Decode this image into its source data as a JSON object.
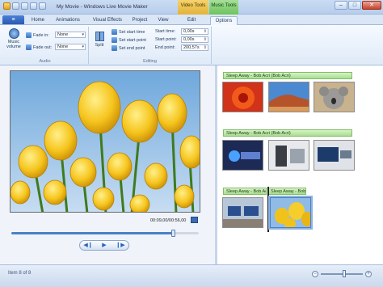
{
  "window": {
    "title": "My Movie - Windows Live Movie Maker",
    "context_tabs": [
      "Video Tools",
      "Music Tools"
    ]
  },
  "tabs": {
    "file_glyph": "≡",
    "items": [
      "Home",
      "Animations",
      "Visual Effects",
      "Project",
      "View",
      "Edit",
      "Options"
    ],
    "active": "Options"
  },
  "ribbon": {
    "audio": {
      "music_volume_label": "Music volume",
      "fade_in_label": "Fade in:",
      "fade_in_value": "None",
      "fade_out_label": "Fade out:",
      "fade_out_value": "None",
      "group_label": "Audio"
    },
    "editing": {
      "split_label": "Split",
      "set_start_time": "Set start time",
      "set_start_point": "Set start point",
      "set_end_point": "Set end point",
      "start_time_label": "Start time:",
      "start_time_value": "0,00s",
      "start_point_label": "Start point:",
      "start_point_value": "0,00s",
      "end_point_label": "End point:",
      "end_point_value": "200,57s",
      "group_label": "Editing"
    }
  },
  "player": {
    "timecode": "00:09,00/00:56,00",
    "progress": 0.86,
    "controls": [
      "◀❙",
      "▶",
      "❙▶"
    ]
  },
  "storyboard": {
    "music_captions": [
      "Sleep Away - Bob Acri (Bob Acri)",
      "Sleep Away - Bob Acri (Bob Acri)",
      "Sleep Away - Bob Acri (Bob Acri)"
    ],
    "caption_split": "Sleep Away - Bob Acri (Bob Acri)"
  },
  "status": {
    "item_text": "Item 8 of 8",
    "zoom_level": 0.55
  },
  "colors": {
    "ribbon_bg": "#dfeaf8",
    "music_caption": "#a9dd92",
    "video_tools": "#e3b23a",
    "music_tools": "#6cc35b"
  }
}
